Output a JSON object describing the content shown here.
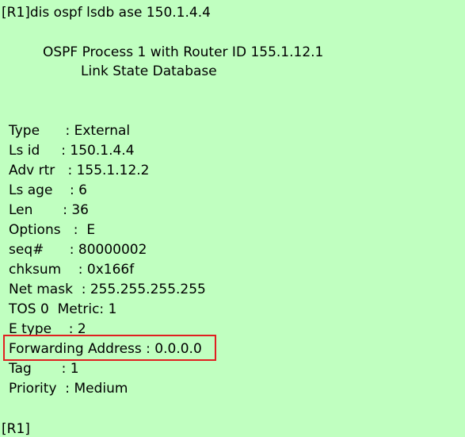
{
  "terminal": {
    "command_line": "[R1]dis ospf lsdb ase 150.1.4.4",
    "header_line1": "OSPF Process 1 with Router ID 155.1.12.1",
    "header_line2": "Link State Database",
    "fields": [
      "Type      : External",
      "Ls id     : 150.1.4.4",
      "Adv rtr   : 155.1.12.2",
      "Ls age    : 6",
      "Len       : 36",
      "Options   :  E",
      "seq#      : 80000002",
      "chksum    : 0x166f",
      "Net mask  : 255.255.255.255",
      "TOS 0  Metric: 1",
      "E type    : 2",
      "Forwarding Address : 0.0.0.0",
      "Tag       : 1",
      "Priority  : Medium"
    ],
    "prompt": "[R1]",
    "highlight_color": "#e02020",
    "background_color": "#c0ffc0"
  }
}
